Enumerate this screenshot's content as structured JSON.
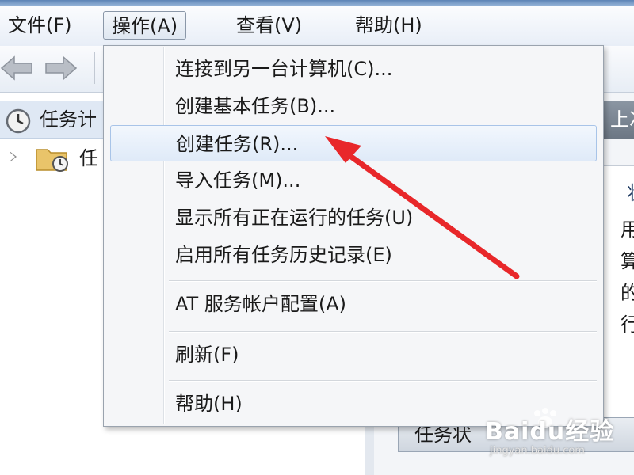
{
  "menubar": {
    "items": [
      {
        "label": "文件(F)"
      },
      {
        "label": "操作(A)"
      },
      {
        "label": "查看(V)"
      },
      {
        "label": "帮助(H)"
      }
    ]
  },
  "tree": {
    "items": [
      {
        "label": "任务计",
        "icon": "clock-icon"
      },
      {
        "label": "任",
        "icon": "folder-clock-icon"
      }
    ]
  },
  "right_pane": {
    "header_text": "上次",
    "tab_fragment": "状",
    "lines": [
      "用任",
      "算机",
      "的常",
      "行操"
    ]
  },
  "bottom_button": "任务状",
  "menu": {
    "items": [
      {
        "label": "连接到另一台计算机(C)..."
      },
      {
        "label": "创建基本任务(B)..."
      },
      {
        "label": "创建任务(R)..."
      },
      {
        "label": "导入任务(M)..."
      },
      {
        "label": "显示所有正在运行的任务(U)"
      },
      {
        "label": "启用所有任务历史记录(E)"
      },
      {
        "label": "AT 服务帐户配置(A)"
      },
      {
        "label": "刷新(F)"
      },
      {
        "label": "帮助(H)"
      }
    ],
    "hover_index": 2
  },
  "annotation": {
    "color": "#e8272a"
  },
  "watermark": {
    "main": "Baidu经验",
    "sub": "jingyan.baidu.com"
  }
}
